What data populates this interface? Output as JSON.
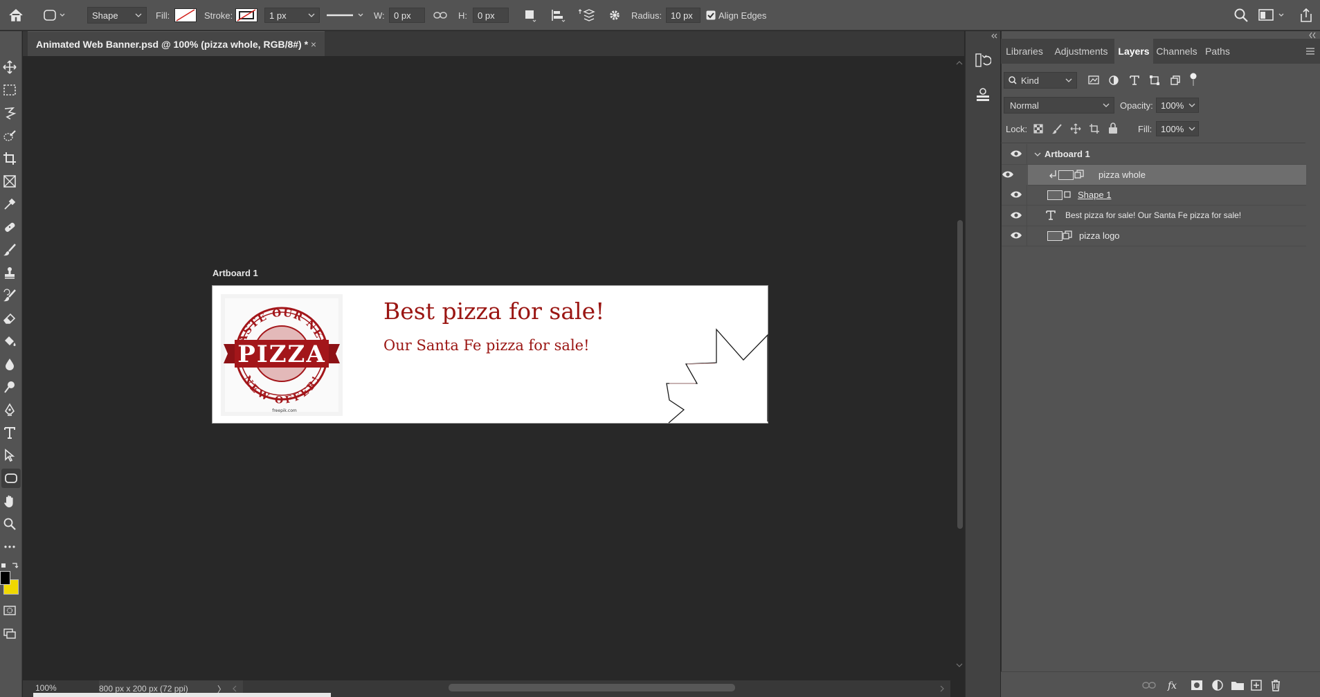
{
  "options_bar": {
    "tool_mode": "Shape",
    "fill_label": "Fill:",
    "stroke_label": "Stroke:",
    "stroke_width": "1 px",
    "w_label": "W:",
    "w_value": "0 px",
    "h_label": "H:",
    "h_value": "0 px",
    "radius_label": "Radius:",
    "radius_value": "10 px",
    "align_edges_label": "Align Edges",
    "align_edges_checked": true
  },
  "document": {
    "tab_title": "Animated Web Banner.psd @ 100% (pizza whole, RGB/8#) *",
    "close_glyph": "×"
  },
  "artboard": {
    "label": "Artboard 1",
    "headline": "Best pizza for sale!",
    "subline": "Our Santa Fe pizza for sale!",
    "logo": {
      "top_arc": "TASTE OUR NEW",
      "banner": "PIZZA",
      "bottom_arc": "NEW OFFER!",
      "credit": "freepik.com"
    }
  },
  "status_bar": {
    "zoom": "100%",
    "doc_info": "800 px x 200 px (72 ppi)",
    "arrow": "〉"
  },
  "panel": {
    "tabs": [
      "Libraries",
      "Adjustments",
      "Layers",
      "Channels",
      "Paths"
    ],
    "active_tab": "Layers",
    "filter_kind": "Kind",
    "blend_mode": "Normal",
    "opacity_label": "Opacity:",
    "opacity_value": "100%",
    "lock_label": "Lock:",
    "fill_label": "Fill:",
    "fill_value": "100%",
    "layers": [
      {
        "name": "Artboard 1",
        "type": "artboard",
        "selected": false
      },
      {
        "name": "pizza whole",
        "type": "smart-object-clipped",
        "selected": true
      },
      {
        "name": "Shape 1",
        "type": "shape",
        "selected": false
      },
      {
        "name": "Best pizza for sale! Our Santa Fe pizza for sale!",
        "type": "text",
        "selected": false
      },
      {
        "name": "pizza logo",
        "type": "smart-object",
        "selected": false
      }
    ]
  },
  "colors": {
    "foreground": "#000000",
    "background": "#f0d800",
    "headline_text": "#9a1512",
    "logo_red": "#a3161a"
  }
}
